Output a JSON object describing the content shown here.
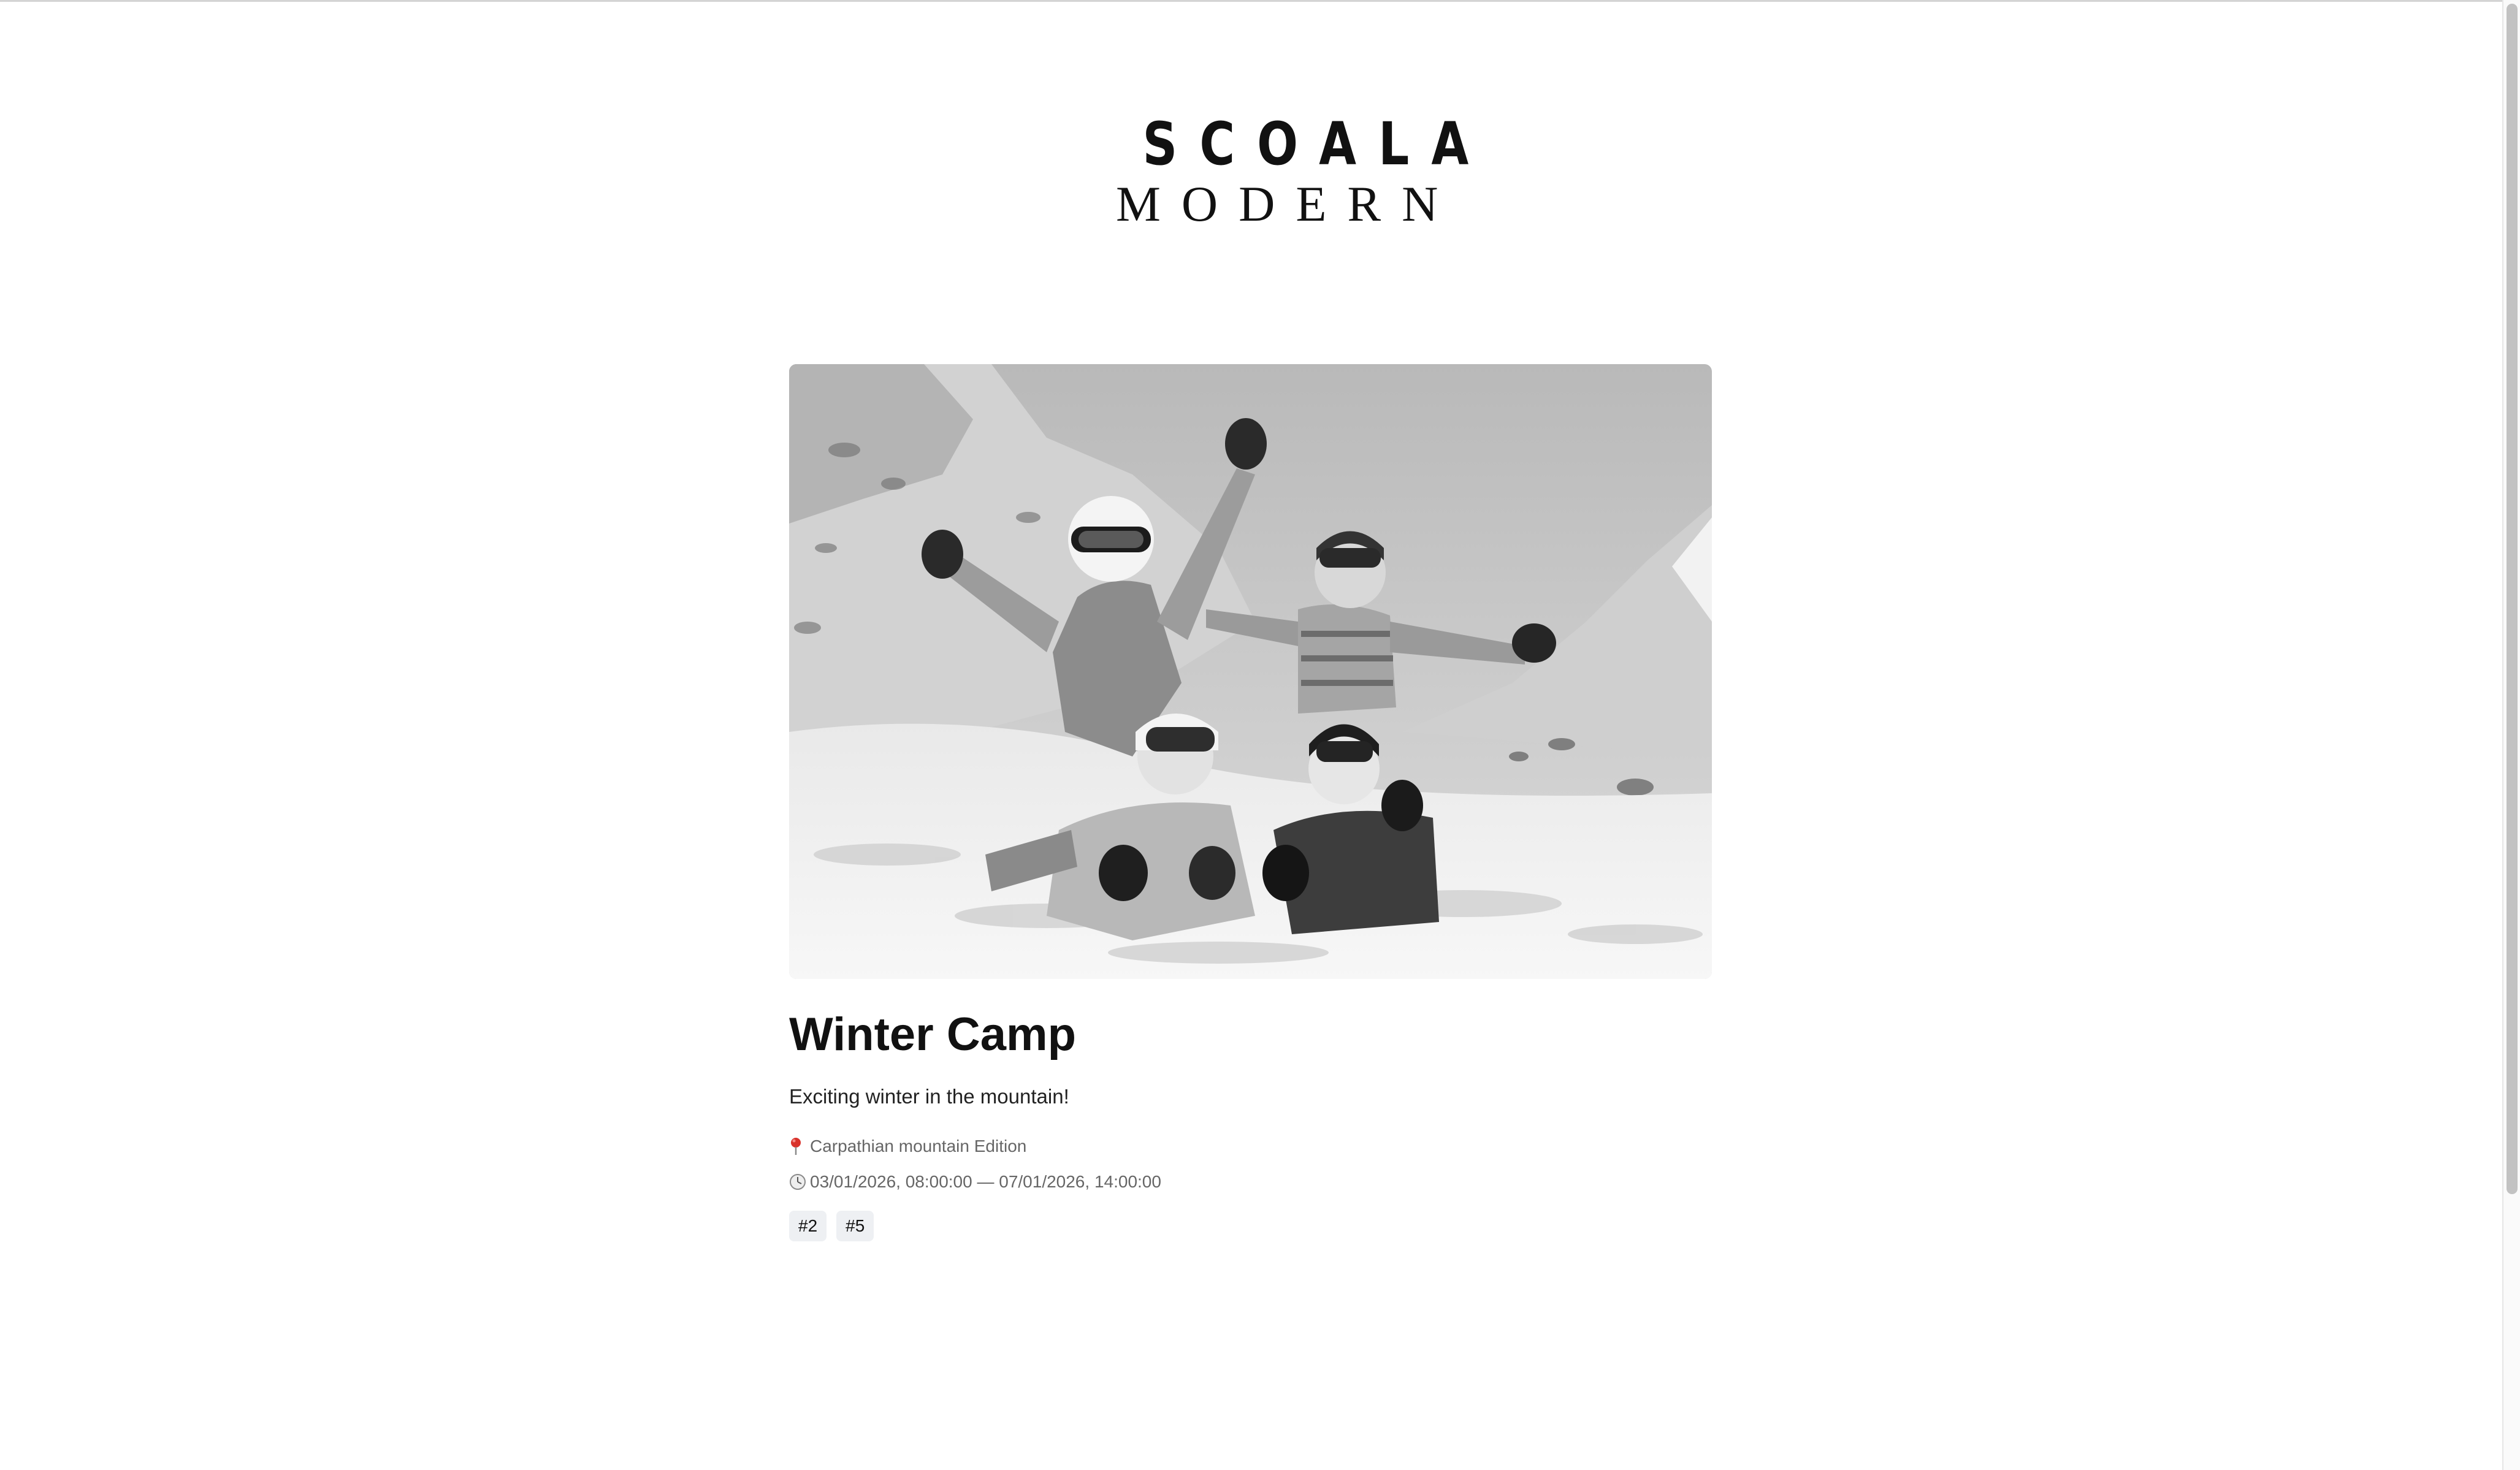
{
  "logo": {
    "line1": "SCOALA",
    "line2": "MODERN"
  },
  "event": {
    "title": "Winter Camp",
    "description": "Exciting winter in the mountain!",
    "location": "Carpathian mountain Edition",
    "datetime": "03/01/2026, 08:00:00 — 07/01/2026, 14:00:00",
    "tags": [
      "#2",
      "#5"
    ]
  },
  "icons": {
    "location": "pin-icon",
    "time": "clock-icon"
  },
  "colors": {
    "background": "#ffffff",
    "text": "#111111",
    "muted": "#666666",
    "tag_bg": "#eef0f3",
    "pin": "#d9322b"
  }
}
